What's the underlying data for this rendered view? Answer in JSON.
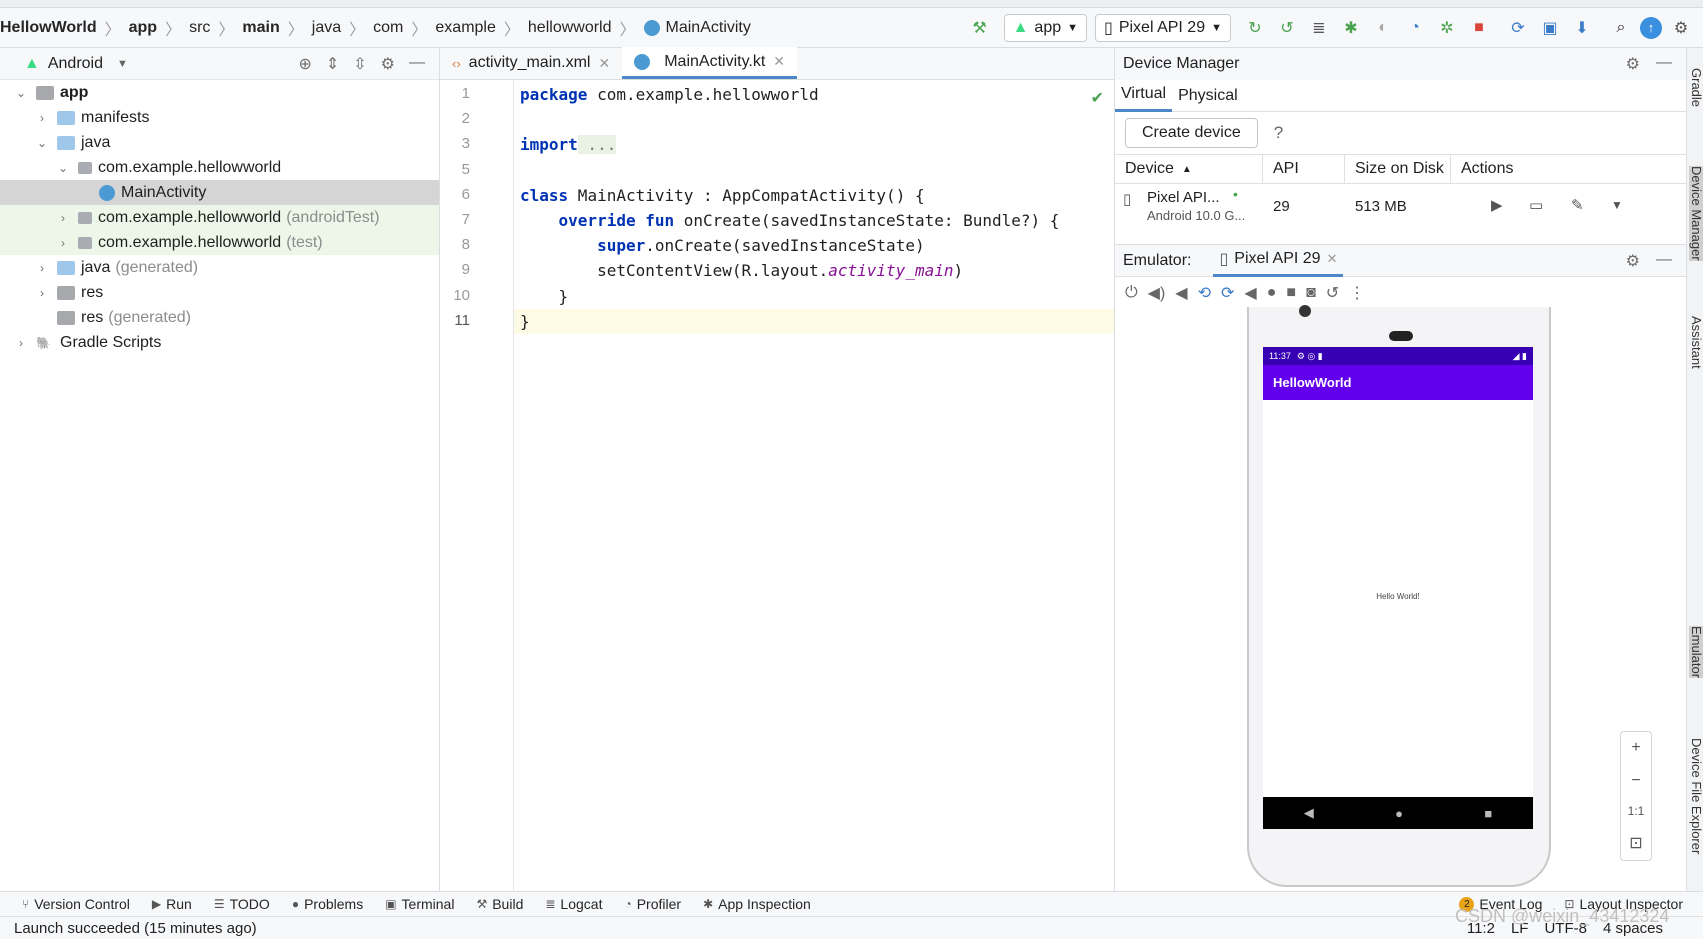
{
  "breadcrumb": [
    "HellowWorld",
    "app",
    "src",
    "main",
    "java",
    "com",
    "example",
    "hellowworld",
    "MainActivity"
  ],
  "toolbar": {
    "config": "app",
    "device": "Pixel API 29"
  },
  "project": {
    "view": "Android",
    "tree": [
      {
        "label": "app",
        "suffix": "",
        "level": 0,
        "kind": "module",
        "open": true,
        "bold": true
      },
      {
        "label": "manifests",
        "suffix": "",
        "level": 1,
        "kind": "folder",
        "open": false
      },
      {
        "label": "java",
        "suffix": "",
        "level": 1,
        "kind": "folder",
        "open": true
      },
      {
        "label": "com.example.hellowworld",
        "suffix": "",
        "level": 2,
        "kind": "package",
        "open": true
      },
      {
        "label": "MainActivity",
        "suffix": "",
        "level": 3,
        "kind": "kotlin",
        "selected": true
      },
      {
        "label": "com.example.hellowworld",
        "suffix": "(androidTest)",
        "level": 2,
        "kind": "package",
        "test": true
      },
      {
        "label": "com.example.hellowworld",
        "suffix": "(test)",
        "level": 2,
        "kind": "package",
        "test": true
      },
      {
        "label": "java",
        "suffix": "(generated)",
        "level": 1,
        "kind": "folder",
        "dim": true
      },
      {
        "label": "res",
        "suffix": "",
        "level": 1,
        "kind": "res"
      },
      {
        "label": "res",
        "suffix": "(generated)",
        "level": 1,
        "kind": "res",
        "leaf": true
      },
      {
        "label": "Gradle Scripts",
        "suffix": "",
        "level": 0,
        "kind": "gradle"
      }
    ]
  },
  "editor": {
    "tabs": [
      {
        "label": "activity_main.xml",
        "active": false
      },
      {
        "label": "MainActivity.kt",
        "active": true
      }
    ],
    "line_numbers": [
      "1",
      "2",
      "3",
      "5",
      "6",
      "7",
      "8",
      "9",
      "10",
      "11"
    ],
    "lines": [
      {
        "kw": "package",
        "text": " com.example.hellowworld"
      },
      {
        "kw": "",
        "text": ""
      },
      {
        "kw": "import",
        "text": " ..."
      },
      {
        "kw": "",
        "text": ""
      },
      {
        "kw": "class",
        "text": " MainActivity : AppCompatActivity() {"
      },
      {
        "kw": "override fun",
        "text": " onCreate(savedInstanceState: Bundle?) {"
      },
      {
        "kw": "super",
        "text": ".onCreate(savedInstanceState)"
      },
      {
        "kw": "",
        "text": "setContentView(R.layout.",
        "italic": "activity_main",
        "tail": ")"
      },
      {
        "kw": "",
        "text": "}"
      },
      {
        "kw": "",
        "text": "}"
      }
    ]
  },
  "device_manager": {
    "title": "Device Manager",
    "tabs": [
      "Virtual",
      "Physical"
    ],
    "create_button": "Create device",
    "help": "?",
    "columns": [
      "Device",
      "API",
      "Size on Disk",
      "Actions"
    ],
    "device": {
      "name": "Pixel API...",
      "subtitle": "Android 10.0 G...",
      "api": "29",
      "size": "513 MB"
    }
  },
  "emulator": {
    "label": "Emulator:",
    "tab": "Pixel API 29",
    "phone": {
      "time": "11:37",
      "app_title": "HellowWorld",
      "content": "Hello World!"
    },
    "zoom": [
      "+",
      "−",
      "1:1",
      "⊡"
    ]
  },
  "right_strip": [
    "Gradle",
    "Device Manager",
    "Assistant",
    "Emulator",
    "Device File Explorer"
  ],
  "bottom_tools": [
    "Version Control",
    "Run",
    "TODO",
    "Problems",
    "Terminal",
    "Build",
    "Logcat",
    "Profiler",
    "App Inspection"
  ],
  "bottom_right_tools": {
    "event_log": "Event Log",
    "event_count": "2",
    "layout_inspector": "Layout Inspector"
  },
  "status": {
    "message": "Launch succeeded (15 minutes ago)",
    "position": "11:2",
    "line_sep": "LF",
    "encoding": "UTF-8",
    "indent": "4 spaces"
  },
  "watermark": "CSDN @weixin_43412324",
  "colors": {
    "accent": "#4a88c7",
    "app_bar": "#6200ee",
    "status_bar": "#3700b3",
    "keyword": "#0033b3"
  }
}
